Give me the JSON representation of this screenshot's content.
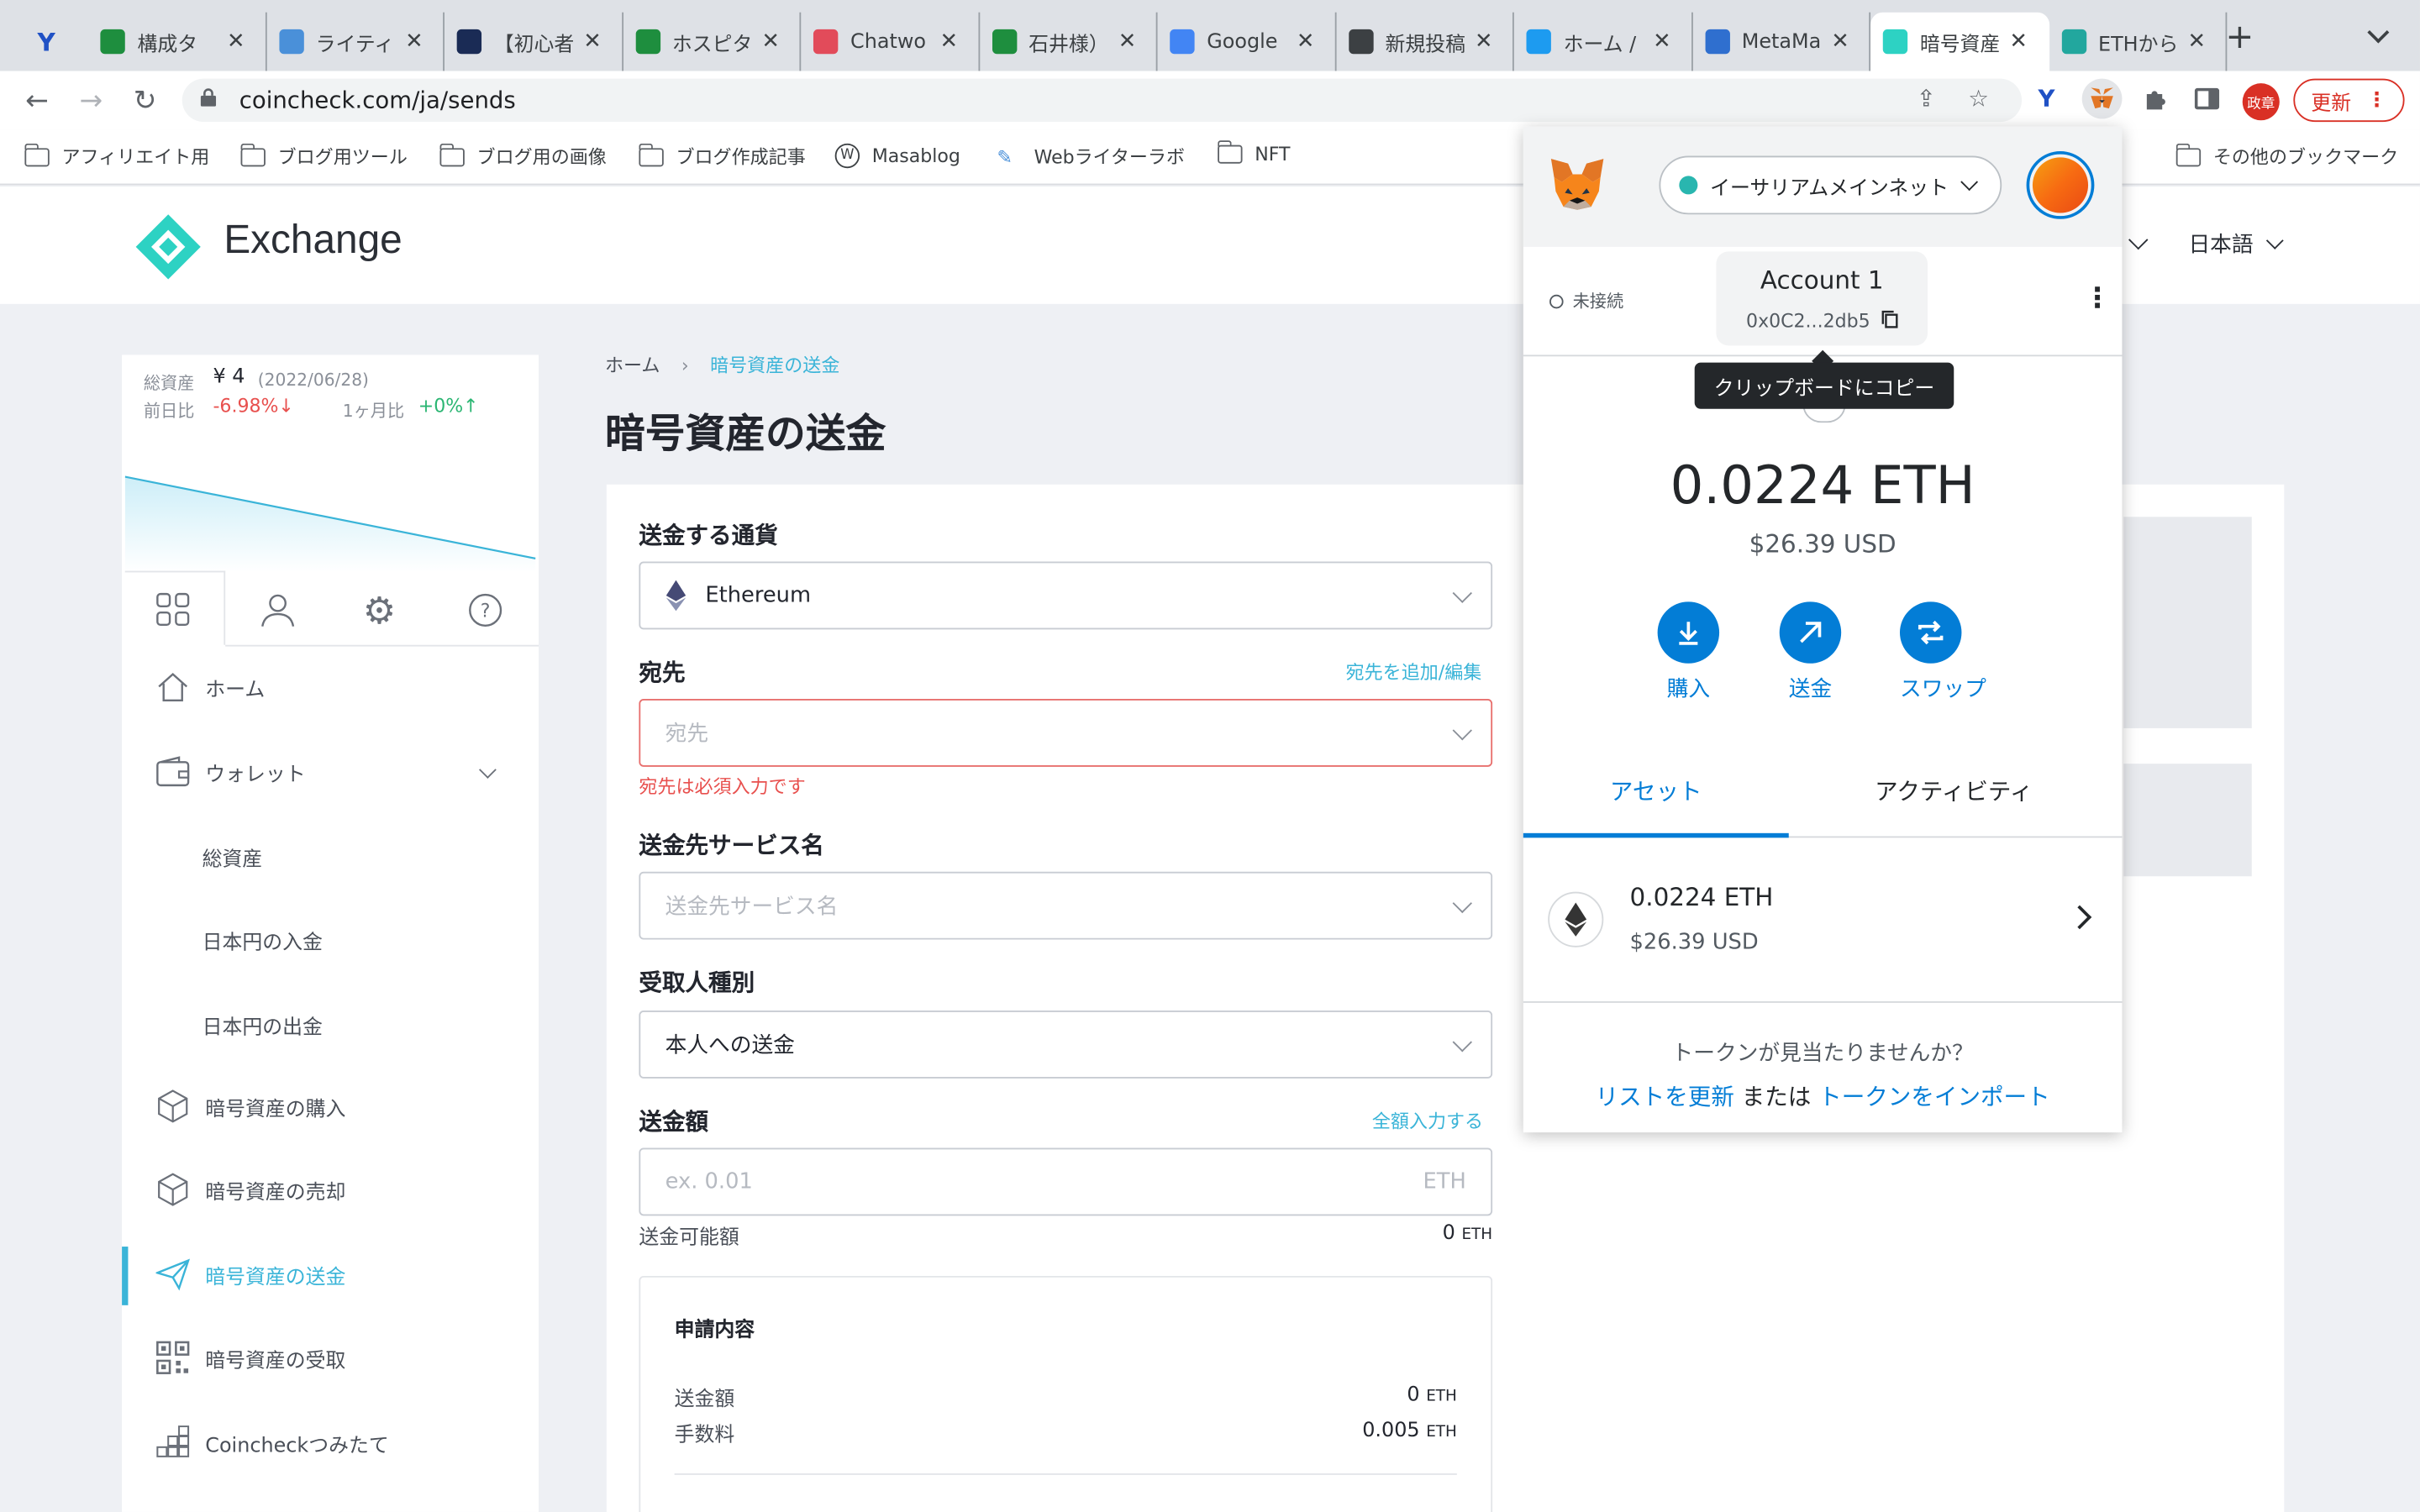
{
  "browser": {
    "tabs": [
      {
        "title": "",
        "color": "#2051c5"
      },
      {
        "title": "構成タ",
        "color": "#1e8e3e"
      },
      {
        "title": "ライティ",
        "color": "#4a90d9"
      },
      {
        "title": "【初心者",
        "color": "#1a2b55"
      },
      {
        "title": "ホスピタ",
        "color": "#1e8e3e"
      },
      {
        "title": "Chatwo",
        "color": "#e24b5a"
      },
      {
        "title": "石井様）",
        "color": "#1e8e3e"
      },
      {
        "title": "Google",
        "color": "#4285f4"
      },
      {
        "title": "新規投稿",
        "color": "#3c4043"
      },
      {
        "title": "ホーム /",
        "color": "#1d9bf0"
      },
      {
        "title": "MetaMa",
        "color": "#2f6fcf"
      },
      {
        "title": "暗号資産",
        "color": "#2dd2c3"
      },
      {
        "title": "ETHから",
        "color": "#22a79e"
      }
    ],
    "url": "coincheck.com/ja/sends",
    "profile_label": "政章",
    "update_label": "更新",
    "bookmarks": [
      "アフィリエイト用",
      "ブログ用ツール",
      "ブログ用の画像",
      "ブログ作成記事",
      "Masablog",
      "Webライターラボ",
      "NFT"
    ],
    "other_bookmarks": "その他のブックマーク"
  },
  "header": {
    "logo_text": "Exchange",
    "language": "日本語"
  },
  "sidebar": {
    "total_label": "総資産",
    "total_value": "¥ 4",
    "total_date": "(2022/06/28)",
    "day_change_label": "前日比",
    "day_change_value": "-6.98%↓",
    "month_change_label": "1ヶ月比",
    "month_change_value": "+0%↑",
    "items": {
      "home": "ホーム",
      "wallet": "ウォレット",
      "total_assets": "総資産",
      "jpy_deposit": "日本円の入金",
      "jpy_withdraw": "日本円の出金",
      "buy": "暗号資産の購入",
      "sell": "暗号資産の売却",
      "send": "暗号資産の送金",
      "receive": "暗号資産の受取",
      "tsumitate": "Coincheckつみたて"
    }
  },
  "main": {
    "breadcrumb_home": "ホーム",
    "breadcrumb_current": "暗号資産の送金",
    "title": "暗号資産の送金",
    "currency_label": "送金する通貨",
    "currency_value": "Ethereum",
    "dest_label": "宛先",
    "dest_link": "宛先を追加/編集",
    "dest_placeholder": "宛先",
    "dest_error": "宛先は必須入力です",
    "service_label": "送金先サービス名",
    "service_placeholder": "送金先サービス名",
    "recipient_label": "受取人種別",
    "recipient_value": "本人への送金",
    "amount_label": "送金額",
    "amount_link": "全額入力する",
    "amount_placeholder": "ex. 0.01",
    "amount_unit": "ETH",
    "available_label": "送金可能額",
    "available_value": "0",
    "available_unit": "ETH",
    "summary_title": "申請内容",
    "summary_amount_label": "送金額",
    "summary_amount_value": "0",
    "summary_fee_label": "手数料",
    "summary_fee_value": "0.005",
    "summary_unit": "ETH"
  },
  "metamask": {
    "network": "イーサリアムメインネット",
    "status": "未接続",
    "account_name": "Account 1",
    "address": "0x0C2...2db5",
    "tooltip": "クリップボードにコピー",
    "balance": "0.0224 ETH",
    "balance_usd": "$26.39 USD",
    "buy_label": "購入",
    "send_label": "送金",
    "swap_label": "スワップ",
    "tab_assets": "アセット",
    "tab_activity": "アクティビティ",
    "asset_name": "0.0224 ETH",
    "asset_usd": "$26.39 USD",
    "missing_text": "トークンが見当たりませんか？",
    "refresh_link": "リストを更新",
    "or_text": "または",
    "import_link": "トークンをインポート"
  }
}
